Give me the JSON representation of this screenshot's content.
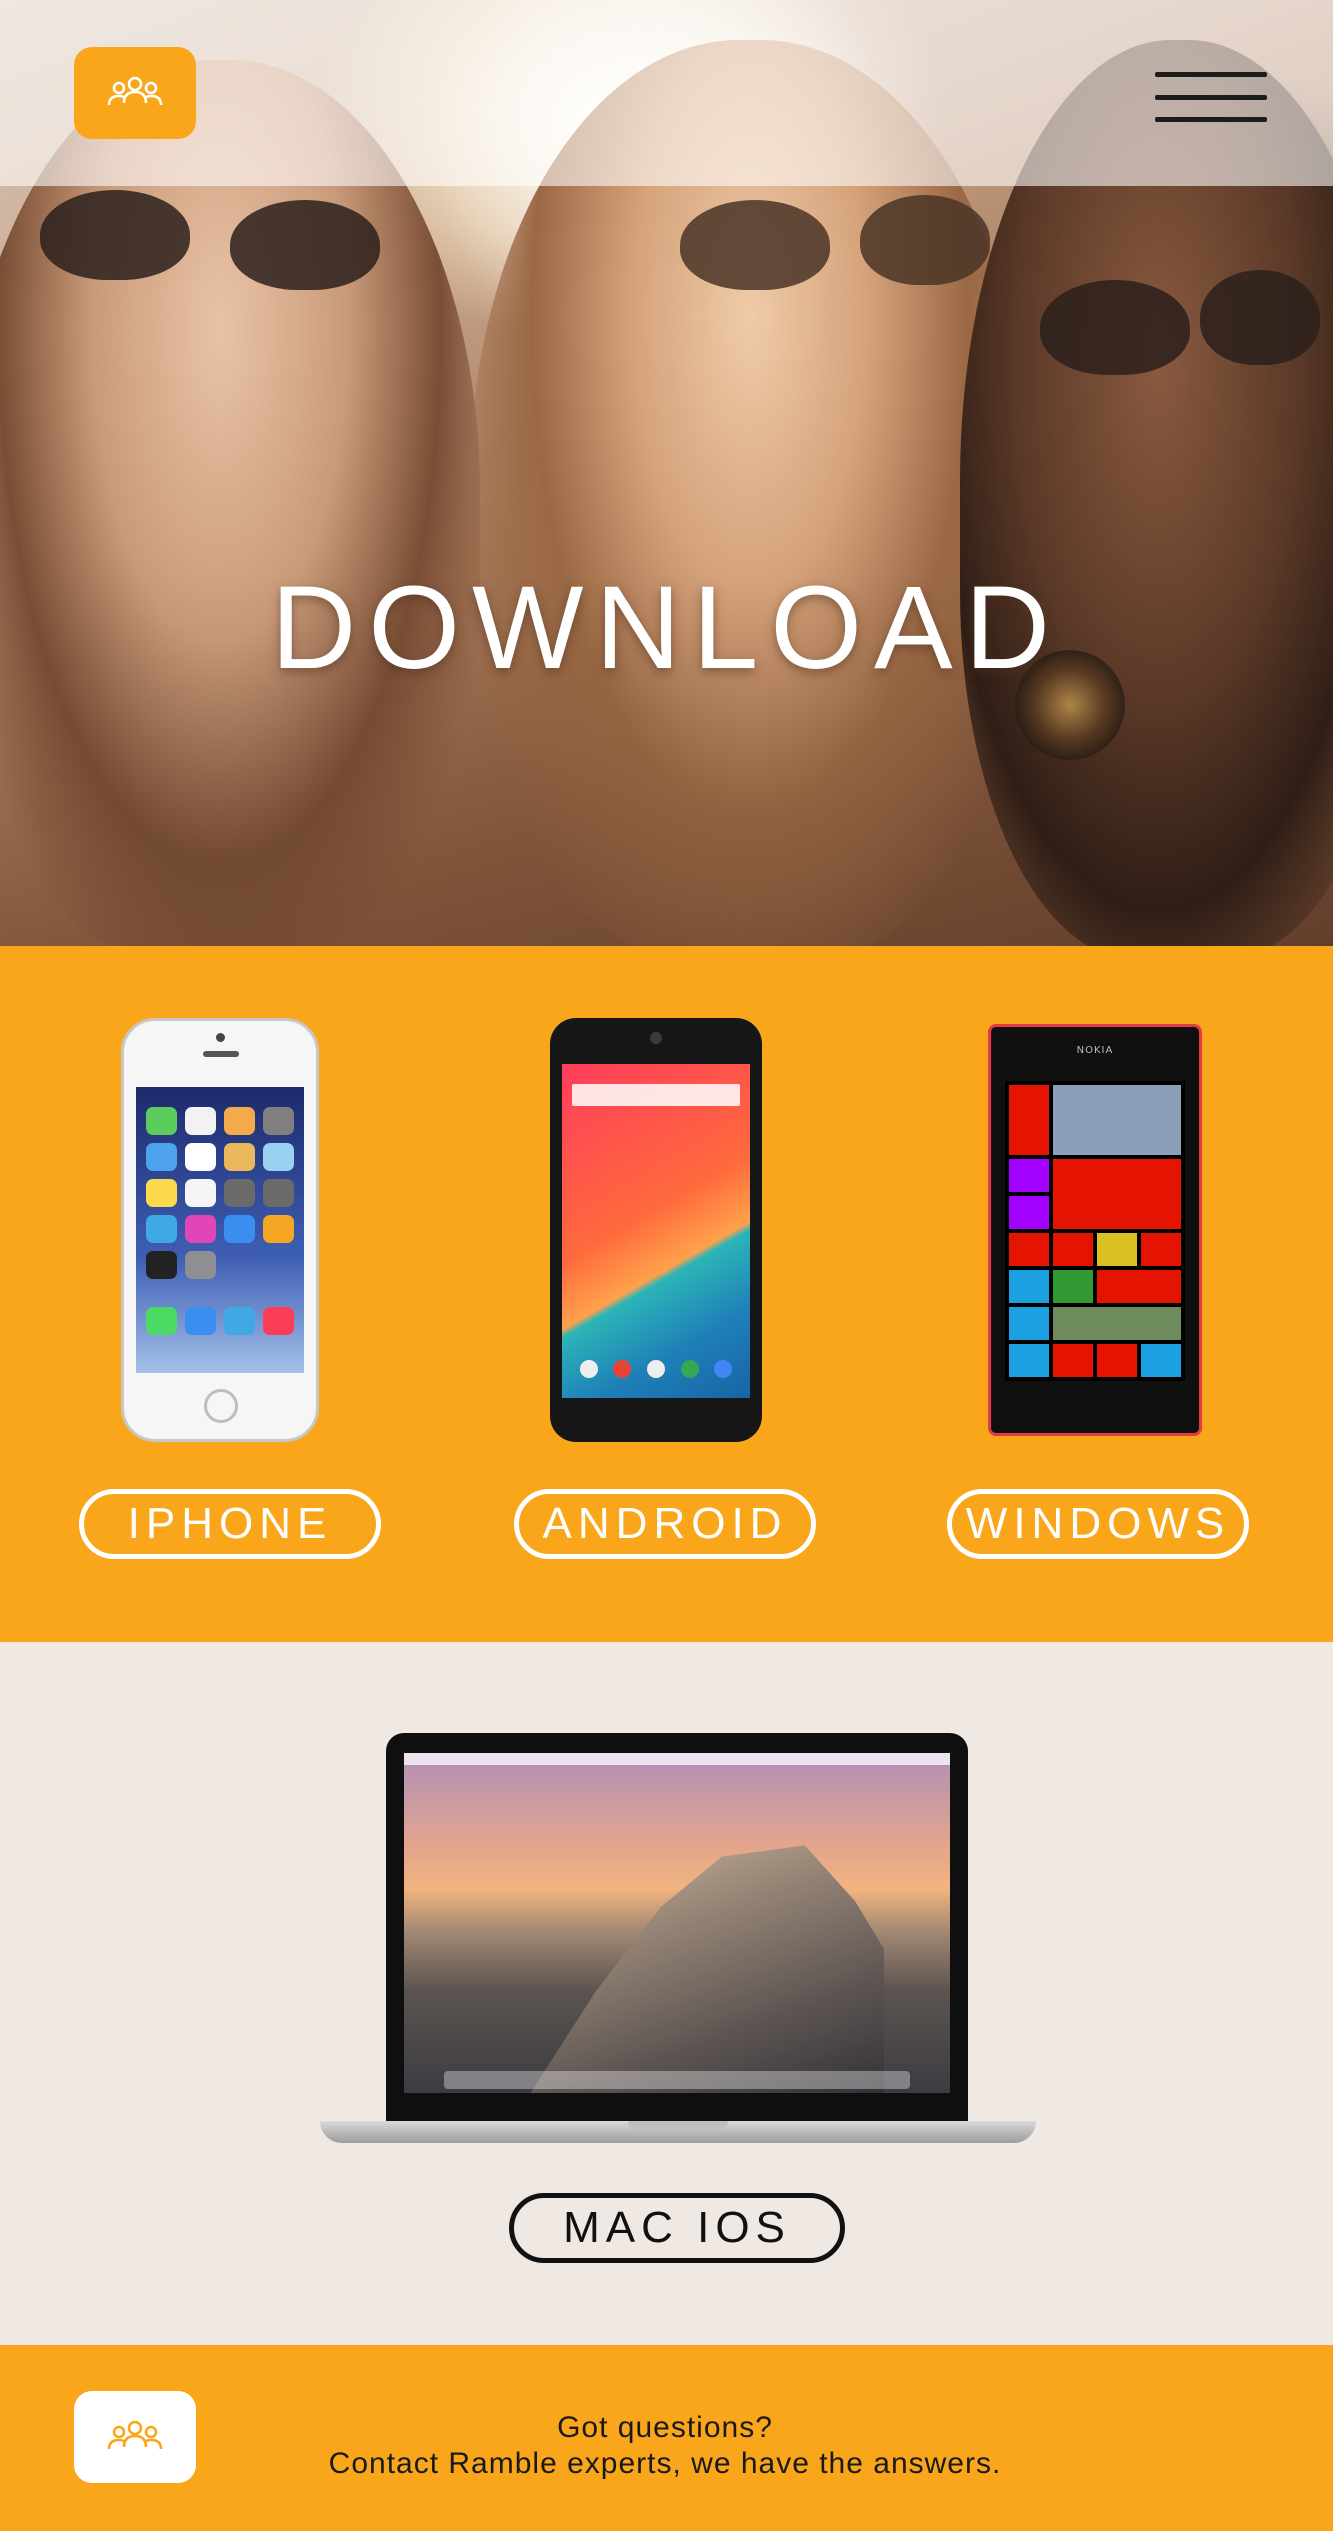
{
  "header": {
    "logo_icon": "group-icon",
    "menu_icon": "hamburger-menu-icon"
  },
  "hero": {
    "title": "DOWNLOAD"
  },
  "platforms": {
    "iphone_label": "IPHONE",
    "android_label": "ANDROID",
    "windows_label": "WINDOWS",
    "mac_label": "MAC IOS",
    "windows_brand": "NOKIA"
  },
  "footer": {
    "logo_icon": "group-icon",
    "line1": "Got questions?",
    "line2": "Contact Ramble experts, we have the answers."
  },
  "colors": {
    "accent": "#f9a61a",
    "light_bg": "#f0e8e3",
    "dark": "#111111",
    "white": "#ffffff"
  }
}
